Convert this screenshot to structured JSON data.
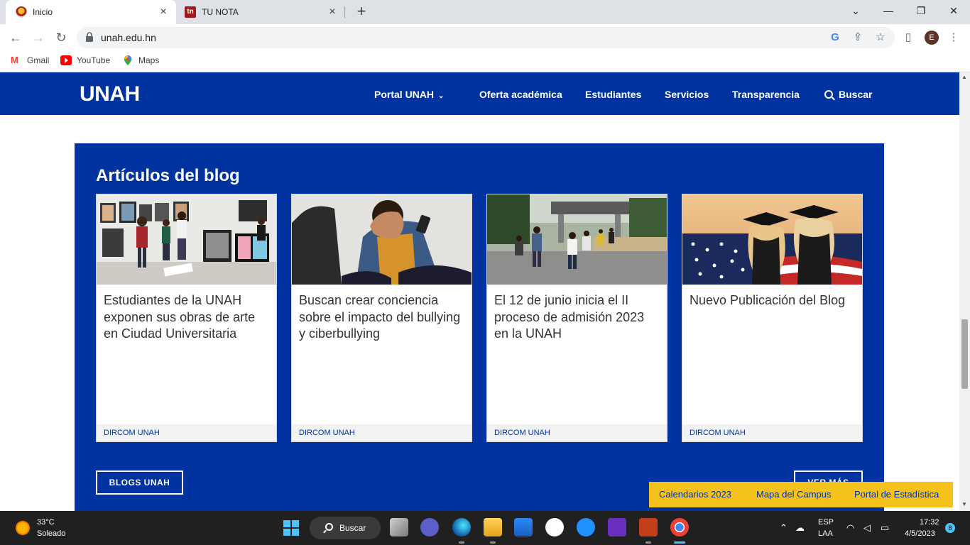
{
  "browser": {
    "tabs": [
      {
        "title": "Inicio",
        "active": true
      },
      {
        "title": "TU NOTA",
        "active": false
      }
    ],
    "url": "unah.edu.hn",
    "profile_initial": "E",
    "bookmarks": [
      "Gmail",
      "YouTube",
      "Maps"
    ]
  },
  "site": {
    "logo": "UNAH",
    "nav": [
      "Portal UNAH",
      "Oferta académica",
      "Estudiantes",
      "Servicios",
      "Transparencia",
      "Buscar"
    ],
    "colors": {
      "primary": "#0033a0",
      "accent": "#f4c21a"
    }
  },
  "blog": {
    "title": "Artículos del blog",
    "cards": [
      {
        "title": "Estudiantes de la UNAH exponen sus obras de arte en Ciudad Universitaria",
        "author": "DIRCOM UNAH"
      },
      {
        "title": "Buscan crear conciencia sobre el impacto del bullying y ciberbullying",
        "author": "DIRCOM UNAH"
      },
      {
        "title": "El 12 de junio inicia el II proceso de admisión 2023 en la UNAH",
        "author": "DIRCOM UNAH"
      },
      {
        "title": "Nuevo Publicación del Blog",
        "author": "DIRCOM UNAH"
      }
    ],
    "blogs_button": "BLOGS UNAH",
    "more_button": "VER MÁS"
  },
  "floating_links": [
    "Calendarios 2023",
    "Mapa del Campus",
    "Portal de Estadística"
  ],
  "taskbar": {
    "weather_temp": "33°C",
    "weather_desc": "Soleado",
    "search_label": "Buscar",
    "lang_line1": "ESP",
    "lang_line2": "LAA",
    "time": "17:32",
    "date": "4/5/2023",
    "notifications": "8"
  }
}
